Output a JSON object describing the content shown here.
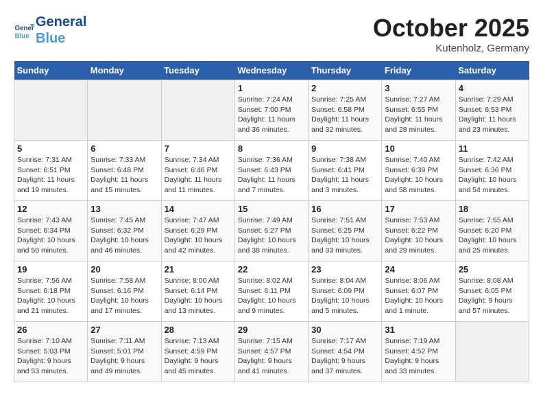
{
  "header": {
    "logo_line1": "General",
    "logo_line2": "Blue",
    "month": "October 2025",
    "location": "Kutenholz, Germany"
  },
  "weekdays": [
    "Sunday",
    "Monday",
    "Tuesday",
    "Wednesday",
    "Thursday",
    "Friday",
    "Saturday"
  ],
  "weeks": [
    [
      {
        "day": "",
        "info": ""
      },
      {
        "day": "",
        "info": ""
      },
      {
        "day": "",
        "info": ""
      },
      {
        "day": "1",
        "info": "Sunrise: 7:24 AM\nSunset: 7:00 PM\nDaylight: 11 hours\nand 36 minutes."
      },
      {
        "day": "2",
        "info": "Sunrise: 7:25 AM\nSunset: 6:58 PM\nDaylight: 11 hours\nand 32 minutes."
      },
      {
        "day": "3",
        "info": "Sunrise: 7:27 AM\nSunset: 6:55 PM\nDaylight: 11 hours\nand 28 minutes."
      },
      {
        "day": "4",
        "info": "Sunrise: 7:29 AM\nSunset: 6:53 PM\nDaylight: 11 hours\nand 23 minutes."
      }
    ],
    [
      {
        "day": "5",
        "info": "Sunrise: 7:31 AM\nSunset: 6:51 PM\nDaylight: 11 hours\nand 19 minutes."
      },
      {
        "day": "6",
        "info": "Sunrise: 7:33 AM\nSunset: 6:48 PM\nDaylight: 11 hours\nand 15 minutes."
      },
      {
        "day": "7",
        "info": "Sunrise: 7:34 AM\nSunset: 6:46 PM\nDaylight: 11 hours\nand 11 minutes."
      },
      {
        "day": "8",
        "info": "Sunrise: 7:36 AM\nSunset: 6:43 PM\nDaylight: 11 hours\nand 7 minutes."
      },
      {
        "day": "9",
        "info": "Sunrise: 7:38 AM\nSunset: 6:41 PM\nDaylight: 11 hours\nand 3 minutes."
      },
      {
        "day": "10",
        "info": "Sunrise: 7:40 AM\nSunset: 6:39 PM\nDaylight: 10 hours\nand 58 minutes."
      },
      {
        "day": "11",
        "info": "Sunrise: 7:42 AM\nSunset: 6:36 PM\nDaylight: 10 hours\nand 54 minutes."
      }
    ],
    [
      {
        "day": "12",
        "info": "Sunrise: 7:43 AM\nSunset: 6:34 PM\nDaylight: 10 hours\nand 50 minutes."
      },
      {
        "day": "13",
        "info": "Sunrise: 7:45 AM\nSunset: 6:32 PM\nDaylight: 10 hours\nand 46 minutes."
      },
      {
        "day": "14",
        "info": "Sunrise: 7:47 AM\nSunset: 6:29 PM\nDaylight: 10 hours\nand 42 minutes."
      },
      {
        "day": "15",
        "info": "Sunrise: 7:49 AM\nSunset: 6:27 PM\nDaylight: 10 hours\nand 38 minutes."
      },
      {
        "day": "16",
        "info": "Sunrise: 7:51 AM\nSunset: 6:25 PM\nDaylight: 10 hours\nand 33 minutes."
      },
      {
        "day": "17",
        "info": "Sunrise: 7:53 AM\nSunset: 6:22 PM\nDaylight: 10 hours\nand 29 minutes."
      },
      {
        "day": "18",
        "info": "Sunrise: 7:55 AM\nSunset: 6:20 PM\nDaylight: 10 hours\nand 25 minutes."
      }
    ],
    [
      {
        "day": "19",
        "info": "Sunrise: 7:56 AM\nSunset: 6:18 PM\nDaylight: 10 hours\nand 21 minutes."
      },
      {
        "day": "20",
        "info": "Sunrise: 7:58 AM\nSunset: 6:16 PM\nDaylight: 10 hours\nand 17 minutes."
      },
      {
        "day": "21",
        "info": "Sunrise: 8:00 AM\nSunset: 6:14 PM\nDaylight: 10 hours\nand 13 minutes."
      },
      {
        "day": "22",
        "info": "Sunrise: 8:02 AM\nSunset: 6:11 PM\nDaylight: 10 hours\nand 9 minutes."
      },
      {
        "day": "23",
        "info": "Sunrise: 8:04 AM\nSunset: 6:09 PM\nDaylight: 10 hours\nand 5 minutes."
      },
      {
        "day": "24",
        "info": "Sunrise: 8:06 AM\nSunset: 6:07 PM\nDaylight: 10 hours\nand 1 minute."
      },
      {
        "day": "25",
        "info": "Sunrise: 8:08 AM\nSunset: 6:05 PM\nDaylight: 9 hours\nand 57 minutes."
      }
    ],
    [
      {
        "day": "26",
        "info": "Sunrise: 7:10 AM\nSunset: 5:03 PM\nDaylight: 9 hours\nand 53 minutes."
      },
      {
        "day": "27",
        "info": "Sunrise: 7:11 AM\nSunset: 5:01 PM\nDaylight: 9 hours\nand 49 minutes."
      },
      {
        "day": "28",
        "info": "Sunrise: 7:13 AM\nSunset: 4:59 PM\nDaylight: 9 hours\nand 45 minutes."
      },
      {
        "day": "29",
        "info": "Sunrise: 7:15 AM\nSunset: 4:57 PM\nDaylight: 9 hours\nand 41 minutes."
      },
      {
        "day": "30",
        "info": "Sunrise: 7:17 AM\nSunset: 4:54 PM\nDaylight: 9 hours\nand 37 minutes."
      },
      {
        "day": "31",
        "info": "Sunrise: 7:19 AM\nSunset: 4:52 PM\nDaylight: 9 hours\nand 33 minutes."
      },
      {
        "day": "",
        "info": ""
      }
    ]
  ]
}
